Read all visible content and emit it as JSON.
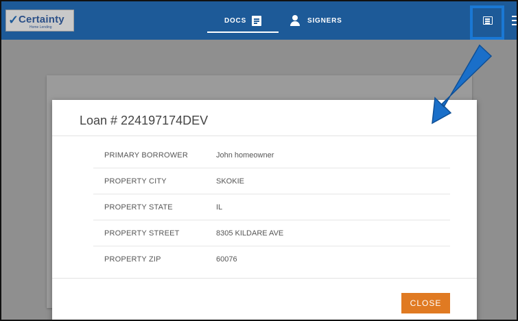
{
  "app": {
    "logo_text": "Certainty",
    "logo_tagline": "Home Lending"
  },
  "nav": {
    "tabs": [
      {
        "label": "DOCS",
        "icon": "document-icon",
        "active": true
      },
      {
        "label": "SIGNERS",
        "icon": "person-icon",
        "active": false
      }
    ]
  },
  "header_actions": {
    "highlighted_icon": "list-icon",
    "menu_icon": "hamburger-menu-icon"
  },
  "modal": {
    "title": "Loan # 224197174DEV",
    "fields": [
      {
        "label": "PRIMARY BORROWER",
        "value": "John homeowner"
      },
      {
        "label": "PROPERTY CITY",
        "value": "SKOKIE"
      },
      {
        "label": "PROPERTY STATE",
        "value": "IL"
      },
      {
        "label": "PROPERTY STREET",
        "value": "8305 KILDARE AVE"
      },
      {
        "label": "PROPERTY ZIP",
        "value": "60076"
      }
    ],
    "close_label": "CLOSE"
  },
  "colors": {
    "app_bar": "#1d5a98",
    "highlight": "#1a78d4",
    "close_button": "#e07a22",
    "overlay": "#8f8f8f"
  }
}
